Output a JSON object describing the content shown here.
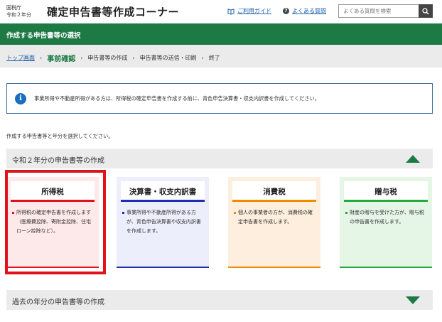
{
  "header": {
    "agency_line1": "国税庁",
    "agency_line2": "令和２年分",
    "title": "確定申告書等作成コーナー",
    "guide_link": "ご利用ガイド",
    "faq_link": "よくある質問",
    "search_placeholder": "よくある質問を検索"
  },
  "page_heading": "作成する申告書等の選択",
  "breadcrumb": {
    "home": "トップ画面",
    "current": "事前確認",
    "step3": "申告書等の作成",
    "step4": "申告書等の送信・印刷",
    "step5": "終了"
  },
  "info": {
    "text": "事業所得や不動産所得がある方は、所得税の確定申告書を作成する前に、青色申告決算書・収支内訳書を作成してください。"
  },
  "select_prompt": "作成する申告書等と年分を選択してください。",
  "section_current": {
    "title": "令和２年分の申告書等の作成",
    "state": "expanded"
  },
  "cards": [
    {
      "title": "所得税",
      "desc": "所得税の確定申告書を作成します（医療費控除、寄附金控除、住宅ローン控除など）。",
      "accent": "#e0121b",
      "selected": true
    },
    {
      "title": "決算書・収支内訳書",
      "desc": "事業所得や不動産所得がある方が、青色申告決算書や収支内訳書を作成します。",
      "accent": "#1d2fb0",
      "selected": false
    },
    {
      "title": "消費税",
      "desc": "個人の事業者の方が、消費税の確定申告書を作成します。",
      "accent": "#f08c00",
      "selected": false
    },
    {
      "title": "贈与税",
      "desc": "財産の贈与を受けた方が、贈与税の申告書を作成します。",
      "accent": "#27a83c",
      "selected": false
    }
  ],
  "section_past": {
    "title": "過去の年分の申告書等の作成",
    "state": "collapsed"
  },
  "colors": {
    "brand_green": "#1d7a45",
    "link_blue": "#1a5fa8",
    "selection_red": "#e0121b"
  }
}
